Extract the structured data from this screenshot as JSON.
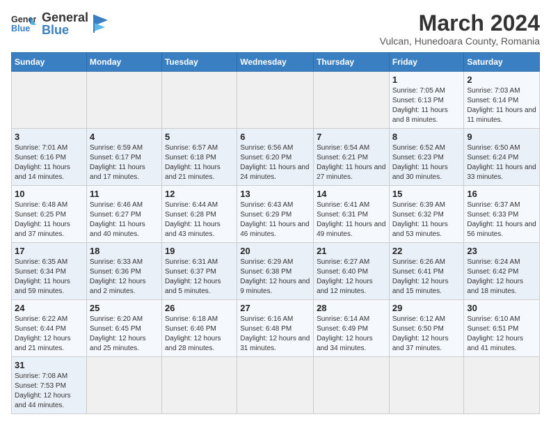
{
  "header": {
    "logo_general": "General",
    "logo_blue": "Blue",
    "month_year": "March 2024",
    "location": "Vulcan, Hunedoara County, Romania"
  },
  "weekdays": [
    "Sunday",
    "Monday",
    "Tuesday",
    "Wednesday",
    "Thursday",
    "Friday",
    "Saturday"
  ],
  "weeks": [
    [
      {
        "day": "",
        "info": ""
      },
      {
        "day": "",
        "info": ""
      },
      {
        "day": "",
        "info": ""
      },
      {
        "day": "",
        "info": ""
      },
      {
        "day": "",
        "info": ""
      },
      {
        "day": "1",
        "info": "Sunrise: 7:05 AM\nSunset: 6:13 PM\nDaylight: 11 hours\nand 8 minutes."
      },
      {
        "day": "2",
        "info": "Sunrise: 7:03 AM\nSunset: 6:14 PM\nDaylight: 11 hours\nand 11 minutes."
      }
    ],
    [
      {
        "day": "3",
        "info": "Sunrise: 7:01 AM\nSunset: 6:16 PM\nDaylight: 11 hours\nand 14 minutes."
      },
      {
        "day": "4",
        "info": "Sunrise: 6:59 AM\nSunset: 6:17 PM\nDaylight: 11 hours\nand 17 minutes."
      },
      {
        "day": "5",
        "info": "Sunrise: 6:57 AM\nSunset: 6:18 PM\nDaylight: 11 hours\nand 21 minutes."
      },
      {
        "day": "6",
        "info": "Sunrise: 6:56 AM\nSunset: 6:20 PM\nDaylight: 11 hours\nand 24 minutes."
      },
      {
        "day": "7",
        "info": "Sunrise: 6:54 AM\nSunset: 6:21 PM\nDaylight: 11 hours\nand 27 minutes."
      },
      {
        "day": "8",
        "info": "Sunrise: 6:52 AM\nSunset: 6:23 PM\nDaylight: 11 hours\nand 30 minutes."
      },
      {
        "day": "9",
        "info": "Sunrise: 6:50 AM\nSunset: 6:24 PM\nDaylight: 11 hours\nand 33 minutes."
      }
    ],
    [
      {
        "day": "10",
        "info": "Sunrise: 6:48 AM\nSunset: 6:25 PM\nDaylight: 11 hours\nand 37 minutes."
      },
      {
        "day": "11",
        "info": "Sunrise: 6:46 AM\nSunset: 6:27 PM\nDaylight: 11 hours\nand 40 minutes."
      },
      {
        "day": "12",
        "info": "Sunrise: 6:44 AM\nSunset: 6:28 PM\nDaylight: 11 hours\nand 43 minutes."
      },
      {
        "day": "13",
        "info": "Sunrise: 6:43 AM\nSunset: 6:29 PM\nDaylight: 11 hours\nand 46 minutes."
      },
      {
        "day": "14",
        "info": "Sunrise: 6:41 AM\nSunset: 6:31 PM\nDaylight: 11 hours\nand 49 minutes."
      },
      {
        "day": "15",
        "info": "Sunrise: 6:39 AM\nSunset: 6:32 PM\nDaylight: 11 hours\nand 53 minutes."
      },
      {
        "day": "16",
        "info": "Sunrise: 6:37 AM\nSunset: 6:33 PM\nDaylight: 11 hours\nand 56 minutes."
      }
    ],
    [
      {
        "day": "17",
        "info": "Sunrise: 6:35 AM\nSunset: 6:34 PM\nDaylight: 11 hours\nand 59 minutes."
      },
      {
        "day": "18",
        "info": "Sunrise: 6:33 AM\nSunset: 6:36 PM\nDaylight: 12 hours\nand 2 minutes."
      },
      {
        "day": "19",
        "info": "Sunrise: 6:31 AM\nSunset: 6:37 PM\nDaylight: 12 hours\nand 5 minutes."
      },
      {
        "day": "20",
        "info": "Sunrise: 6:29 AM\nSunset: 6:38 PM\nDaylight: 12 hours\nand 9 minutes."
      },
      {
        "day": "21",
        "info": "Sunrise: 6:27 AM\nSunset: 6:40 PM\nDaylight: 12 hours\nand 12 minutes."
      },
      {
        "day": "22",
        "info": "Sunrise: 6:26 AM\nSunset: 6:41 PM\nDaylight: 12 hours\nand 15 minutes."
      },
      {
        "day": "23",
        "info": "Sunrise: 6:24 AM\nSunset: 6:42 PM\nDaylight: 12 hours\nand 18 minutes."
      }
    ],
    [
      {
        "day": "24",
        "info": "Sunrise: 6:22 AM\nSunset: 6:44 PM\nDaylight: 12 hours\nand 21 minutes."
      },
      {
        "day": "25",
        "info": "Sunrise: 6:20 AM\nSunset: 6:45 PM\nDaylight: 12 hours\nand 25 minutes."
      },
      {
        "day": "26",
        "info": "Sunrise: 6:18 AM\nSunset: 6:46 PM\nDaylight: 12 hours\nand 28 minutes."
      },
      {
        "day": "27",
        "info": "Sunrise: 6:16 AM\nSunset: 6:48 PM\nDaylight: 12 hours\nand 31 minutes."
      },
      {
        "day": "28",
        "info": "Sunrise: 6:14 AM\nSunset: 6:49 PM\nDaylight: 12 hours\nand 34 minutes."
      },
      {
        "day": "29",
        "info": "Sunrise: 6:12 AM\nSunset: 6:50 PM\nDaylight: 12 hours\nand 37 minutes."
      },
      {
        "day": "30",
        "info": "Sunrise: 6:10 AM\nSunset: 6:51 PM\nDaylight: 12 hours\nand 41 minutes."
      }
    ],
    [
      {
        "day": "31",
        "info": "Sunrise: 7:08 AM\nSunset: 7:53 PM\nDaylight: 12 hours\nand 44 minutes."
      },
      {
        "day": "",
        "info": ""
      },
      {
        "day": "",
        "info": ""
      },
      {
        "day": "",
        "info": ""
      },
      {
        "day": "",
        "info": ""
      },
      {
        "day": "",
        "info": ""
      },
      {
        "day": "",
        "info": ""
      }
    ]
  ]
}
